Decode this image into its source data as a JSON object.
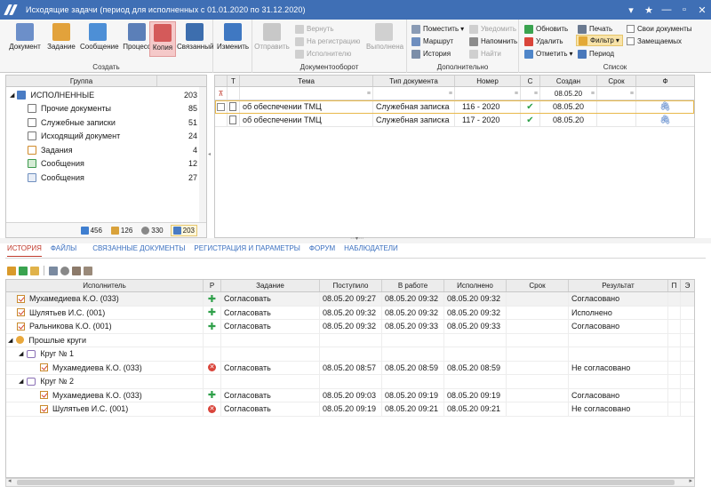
{
  "window": {
    "title": "Исходящие задачи (период для исполненных с 01.01.2020 по 31.12.2020)"
  },
  "ribbon": {
    "create": {
      "title": "Создать",
      "buttons": [
        "Документ",
        "Задание",
        "Сообщение",
        "Процесс",
        "Копия",
        "Связанный"
      ]
    },
    "edit": {
      "label": "Изменить"
    },
    "docflow": {
      "title": "Документооборот",
      "send": "Отправить",
      "return": "Вернуть",
      "to_registration": "На регистрацию",
      "executor": "Исполнителю",
      "executed": "Выполнена"
    },
    "extra": {
      "title": "Дополнительно",
      "place": "Поместить",
      "route": "Маршрут",
      "history": "История",
      "notify": "Уведомить",
      "remind": "Напомнить",
      "find": "Найти"
    },
    "list": {
      "title": "Список",
      "refresh": "Обновить",
      "delete": "Удалить",
      "mark": "Отметить",
      "print": "Печать",
      "filter": "Фильтр",
      "period": "Период",
      "own_docs": "Свои документы",
      "substitutes": "Замещаемых"
    }
  },
  "groups": {
    "header": "Группа",
    "items": [
      {
        "label": "ИСПОЛНЕННЫЕ",
        "count": "203"
      },
      {
        "label": "Прочие документы",
        "count": "85"
      },
      {
        "label": "Служебные записки",
        "count": "51"
      },
      {
        "label": "Исходящий документ",
        "count": "24"
      },
      {
        "label": "Задания",
        "count": "4"
      },
      {
        "label": "Сообщения",
        "count": "12"
      },
      {
        "label": "Сообщения",
        "count": "27"
      }
    ],
    "footer": [
      "456",
      "126",
      "330",
      "203"
    ]
  },
  "docgrid": {
    "headers": [
      "Т",
      "Тема",
      "Тип документа",
      "Номер",
      "С",
      "Создан",
      "Срок",
      "Ф"
    ],
    "filter_created": "08.05.20",
    "rows": [
      {
        "theme": "об обеспечении ТМЦ",
        "type": "Служебная записка",
        "number": "116 - 2020",
        "created": "08.05.20"
      },
      {
        "theme": "об обеспечении ТМЦ",
        "type": "Служебная записка",
        "number": "117 - 2020",
        "created": "08.05.20"
      }
    ]
  },
  "tabs": [
    "ИСТОРИЯ",
    "ФАЙЛЫ",
    "СВЯЗАННЫЕ ДОКУМЕНТЫ",
    "РЕГИСТРАЦИЯ И ПАРАМЕТРЫ",
    "ФОРУМ",
    "НАБЛЮДАТЕЛИ"
  ],
  "history": {
    "headers": [
      "Исполнитель",
      "Р",
      "Задание",
      "Поступило",
      "В работе",
      "Исполнено",
      "Срок",
      "Результат",
      "П",
      "Э"
    ],
    "rows": [
      {
        "executor": "Мухамедиева К.О. (033)",
        "task": "Согласовать",
        "received": "08.05.20 09:27",
        "inwork": "08.05.20 09:32",
        "done": "08.05.20 09:32",
        "result": "Согласовано"
      },
      {
        "executor": "Шулятьев И.С. (001)",
        "task": "Согласовать",
        "received": "08.05.20 09:32",
        "inwork": "08.05.20 09:32",
        "done": "08.05.20 09:32",
        "result": "Исполнено"
      },
      {
        "executor": "Ральникова К.О. (001)",
        "task": "Согласовать",
        "received": "08.05.20 09:32",
        "inwork": "08.05.20 09:33",
        "done": "08.05.20 09:33",
        "result": "Согласовано"
      },
      {
        "executor": "Прошлые круги"
      },
      {
        "executor": "Круг № 1"
      },
      {
        "executor": "Мухамедиева К.О. (033)",
        "task": "Согласовать",
        "received": "08.05.20 08:57",
        "inwork": "08.05.20 08:59",
        "done": "08.05.20 08:59",
        "result": "Не согласовано"
      },
      {
        "executor": "Круг № 2"
      },
      {
        "executor": "Мухамедиева К.О. (033)",
        "task": "Согласовать",
        "received": "08.05.20 09:03",
        "inwork": "08.05.20 09:19",
        "done": "08.05.20 09:19",
        "result": "Согласовано"
      },
      {
        "executor": "Шулятьев И.С. (001)",
        "task": "Согласовать",
        "received": "08.05.20 09:19",
        "inwork": "08.05.20 09:21",
        "done": "08.05.20 09:21",
        "result": "Не согласовано"
      }
    ]
  },
  "colors": {
    "titlebar": "#3f6fb5",
    "accent_red": "#c0392b",
    "link_blue": "#3a6fbf",
    "ok_green": "#2fa04a"
  }
}
